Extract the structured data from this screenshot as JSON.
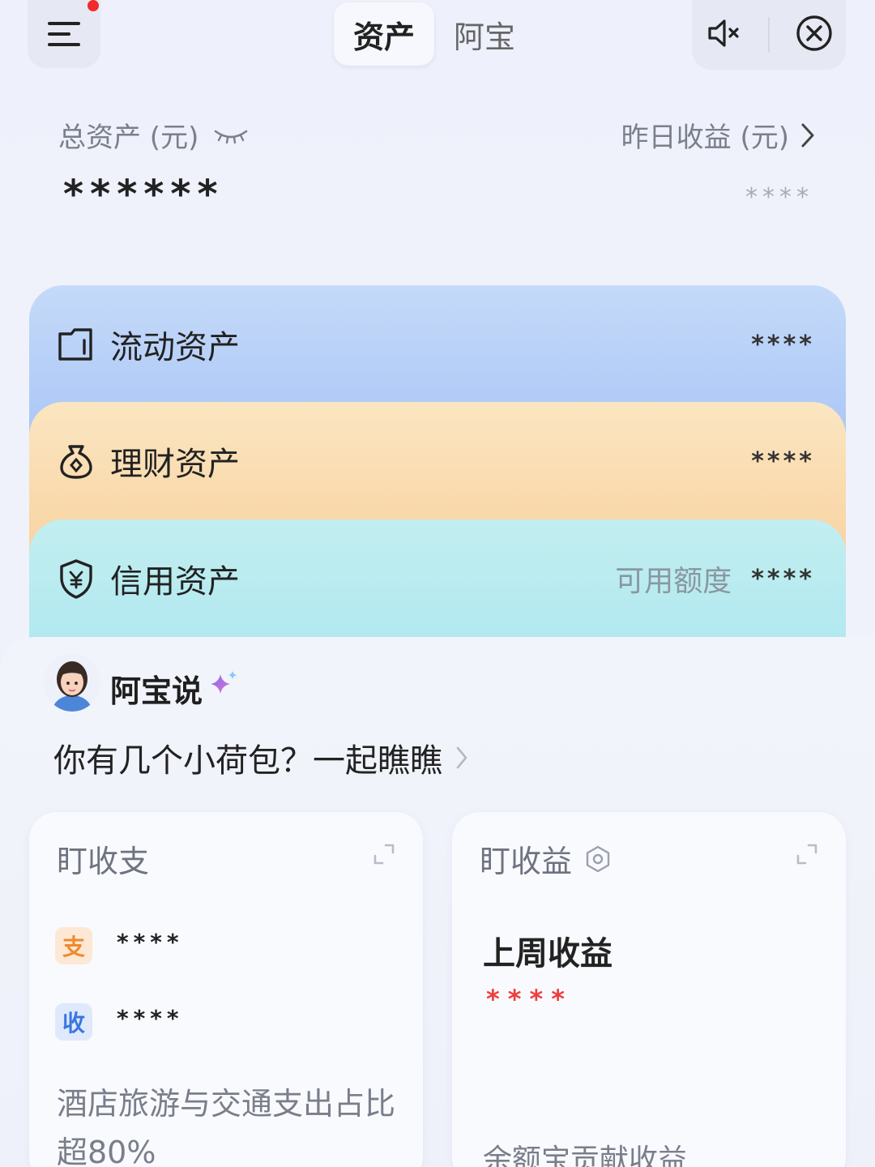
{
  "header": {
    "tabs": [
      {
        "label": "资产",
        "active": true
      },
      {
        "label": "阿宝",
        "active": false
      }
    ],
    "notification_dot_color": "#f02b2b"
  },
  "summary": {
    "total_label": "总资产 (元)",
    "total_value": "******",
    "yesterday_label": "昨日收益 (元)",
    "yesterday_value": "****"
  },
  "assets": [
    {
      "title": "流动资产",
      "value": "****",
      "icon": "wallet-icon",
      "color": "#b4cff8"
    },
    {
      "title": "理财资产",
      "value": "****",
      "icon": "money-bag-icon",
      "color": "#f9dbae"
    },
    {
      "title": "信用资产",
      "sub": "可用额度",
      "value": "****",
      "icon": "yuan-shield-icon",
      "color": "#b1e9ef"
    }
  ],
  "abao": {
    "title": "阿宝说",
    "message": "你有几个小荷包？一起瞧瞧"
  },
  "tiles": {
    "spending": {
      "title": "盯收支",
      "expense_badge": "支",
      "expense_value": "****",
      "income_badge": "收",
      "income_value": "****",
      "desc": "酒店旅游与交通支出占比超80%"
    },
    "earnings": {
      "title": "盯收益",
      "lastweek_label": "上周收益",
      "lastweek_value": "****",
      "desc": "余额宝贡献收益"
    }
  }
}
